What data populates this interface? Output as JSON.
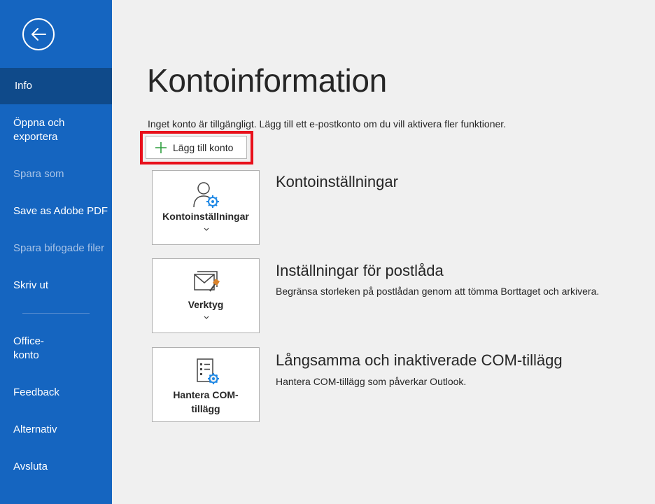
{
  "sidebar": {
    "back_icon": "back-arrow-icon",
    "items": [
      {
        "label": "Info",
        "state": "active"
      },
      {
        "label": "Öppna och exportera",
        "line1": "Öppna och",
        "line2": "exportera",
        "state": "normal"
      },
      {
        "label": "Spara som",
        "state": "disabled"
      },
      {
        "label": "Save as Adobe PDF",
        "state": "normal"
      },
      {
        "label": "Spara bifogade filer",
        "state": "disabled"
      },
      {
        "label": "Skriv ut",
        "state": "normal"
      },
      {
        "label": "Office-konto",
        "line1": "Office-",
        "line2": "konto",
        "state": "normal"
      },
      {
        "label": "Feedback",
        "state": "normal"
      },
      {
        "label": "Alternativ",
        "state": "normal"
      },
      {
        "label": "Avsluta",
        "state": "normal"
      }
    ]
  },
  "main": {
    "title": "Kontoinformation",
    "info_text": "Inget konto är tillgängligt. Lägg till ett e-postkonto om du vill aktivera fler funktioner.",
    "add_account_label": "Lägg till konto",
    "sections": [
      {
        "tile_label": "Kontoinställningar",
        "icon": "account-settings-icon",
        "title": "Kontoinställningar",
        "description": ""
      },
      {
        "tile_label": "Verktyg",
        "icon": "mailbox-tools-icon",
        "title": "Inställningar för postlåda",
        "description": "Begränsa storleken på postlådan genom att tömma Borttaget och arkivera."
      },
      {
        "tile_label_line1": "Hantera COM-",
        "tile_label_line2": "tillägg",
        "icon": "com-addins-icon",
        "title": "Långsamma och inaktiverade COM-tillägg",
        "description": "Hantera COM-tillägg som påverkar Outlook."
      }
    ]
  },
  "colors": {
    "sidebar_bg": "#1565c0",
    "sidebar_active": "#0f4a8a",
    "highlight": "#e8101b",
    "accent_icon": "#1e88e5",
    "plus_green": "#2e9e3e"
  }
}
